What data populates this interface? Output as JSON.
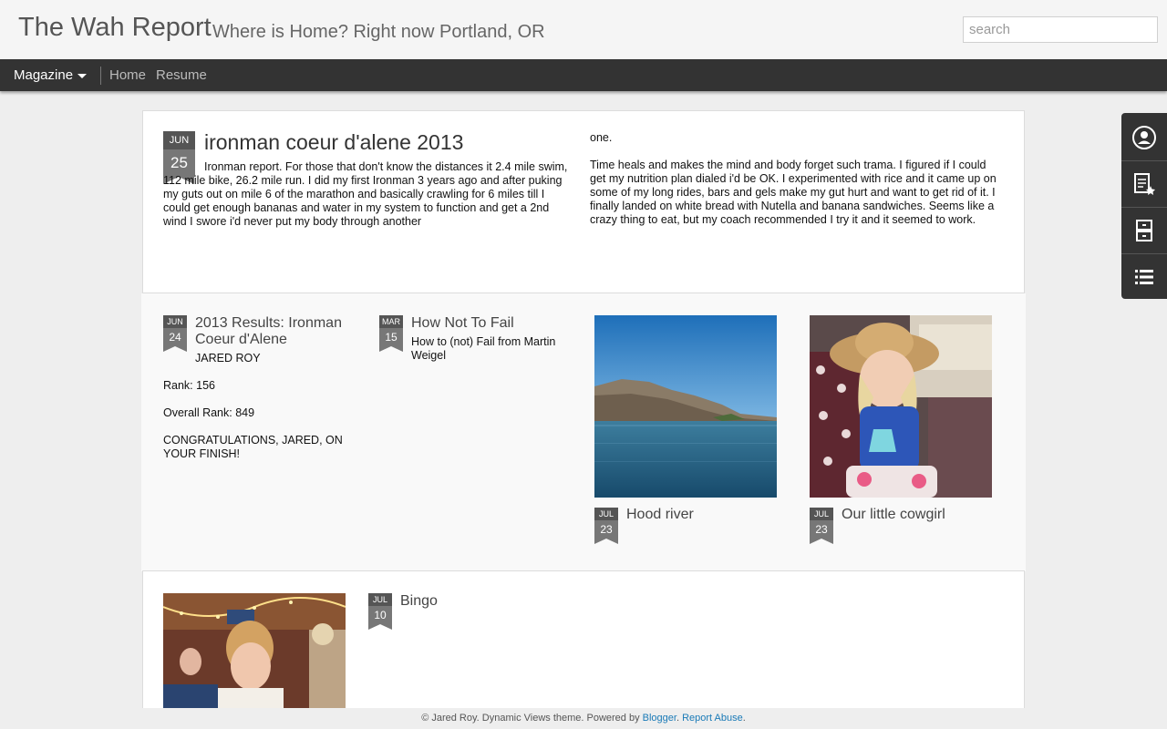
{
  "header": {
    "title": "The Wah Report",
    "description": "Where is Home? Right now Portland, OR",
    "search_placeholder": "search"
  },
  "nav": {
    "view_label": "Magazine",
    "links": [
      "Home",
      "Resume"
    ]
  },
  "feature": {
    "month": "JUN",
    "day": "25",
    "title": "ironman coeur d'alene 2013",
    "text_left": "Ironman report. For those that don't know the distances it 2.4 mile swim, 112 mile bike, 26.2 mile run. I did my first Ironman 3 years ago and after puking my guts out on mile 6 of the marathon and basically crawling for 6 miles till I could get enough bananas and water in my system to function and get a 2nd wind I swore i'd never put my body through another",
    "text_right_1": "one.",
    "text_right_2": "Time heals and makes the mind and body forget such trama. I figured if I could get my nutrition plan dialed i'd be OK. I experimented with rice and it came up on some of my long rides, bars and gels make my gut hurt and want to get rid of it. I finally landed on white bread with Nutella and banana sandwiches. Seems like a crazy thing to eat, but my coach recommended I try it and it seemed to work."
  },
  "posts": [
    {
      "month": "JUN",
      "day": "24",
      "title": "2013 Results: Ironman Coeur d'Alene",
      "subtitle": "JARED ROY",
      "body": [
        "Rank: 156",
        "Overall Rank: 849",
        "CONGRATULATIONS, JARED, ON YOUR FINISH!"
      ]
    },
    {
      "month": "MAR",
      "day": "15",
      "title": "How Not To Fail",
      "subtitle": "How to (not) Fail from Martin Weigel"
    },
    {
      "month": "JUL",
      "day": "23",
      "title": "Hood river"
    },
    {
      "month": "JUL",
      "day": "23",
      "title": "Our little cowgirl"
    },
    {
      "month": "JUL",
      "day": "10",
      "title": "Bingo"
    }
  ],
  "footer": {
    "text": "© Jared Roy. Dynamic Views theme. Powered by",
    "blogger": "Blogger",
    "report": "Report Abuse"
  },
  "side_toolbar": {
    "icons": [
      "profile-icon",
      "subscribe-icon",
      "archive-icon",
      "labels-list-icon"
    ]
  },
  "colors": {
    "nav_bg": "#333333",
    "link": "#1a7ab7",
    "page_bg": "#eeeeee"
  }
}
